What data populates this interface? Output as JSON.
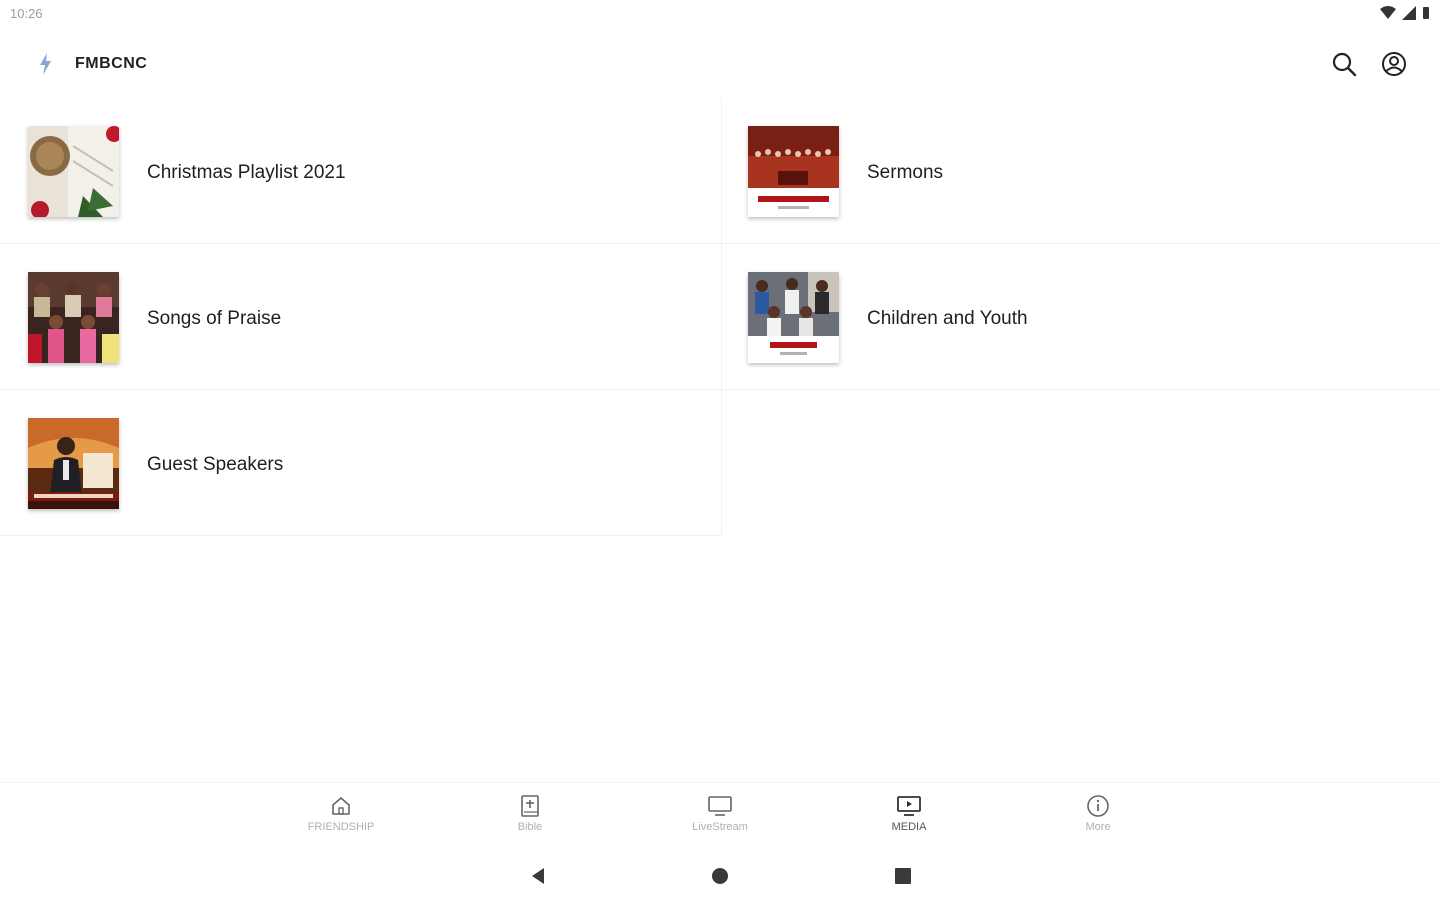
{
  "status_bar": {
    "time": "10:26"
  },
  "app_bar": {
    "title": "FMBCNC",
    "icons": [
      "bolt-logo-icon",
      "search-icon",
      "account-icon"
    ]
  },
  "media_items": [
    {
      "label": "Christmas Playlist 2021",
      "thumbnail": "christmas-ornaments"
    },
    {
      "label": "Sermons",
      "thumbnail": "sunday-worship-congregation"
    },
    {
      "label": "Songs of Praise",
      "thumbnail": "choir-group"
    },
    {
      "label": "Children and Youth",
      "thumbnail": "children-youth-group"
    },
    {
      "label": "Guest Speakers",
      "thumbnail": "speaker-portrait"
    }
  ],
  "bottom_nav": {
    "items": [
      {
        "label": "FRIENDSHIP",
        "icon": "home-icon"
      },
      {
        "label": "Bible",
        "icon": "bible-icon"
      },
      {
        "label": "LiveStream",
        "icon": "monitor-icon"
      },
      {
        "label": "MEDIA",
        "icon": "media-player-icon"
      },
      {
        "label": "More",
        "icon": "info-icon"
      }
    ],
    "active": "MEDIA"
  },
  "colors": {
    "text_primary": "#1f1f1f",
    "nav_inactive": "#b0b0b0",
    "divider": "#f0f0f0"
  }
}
